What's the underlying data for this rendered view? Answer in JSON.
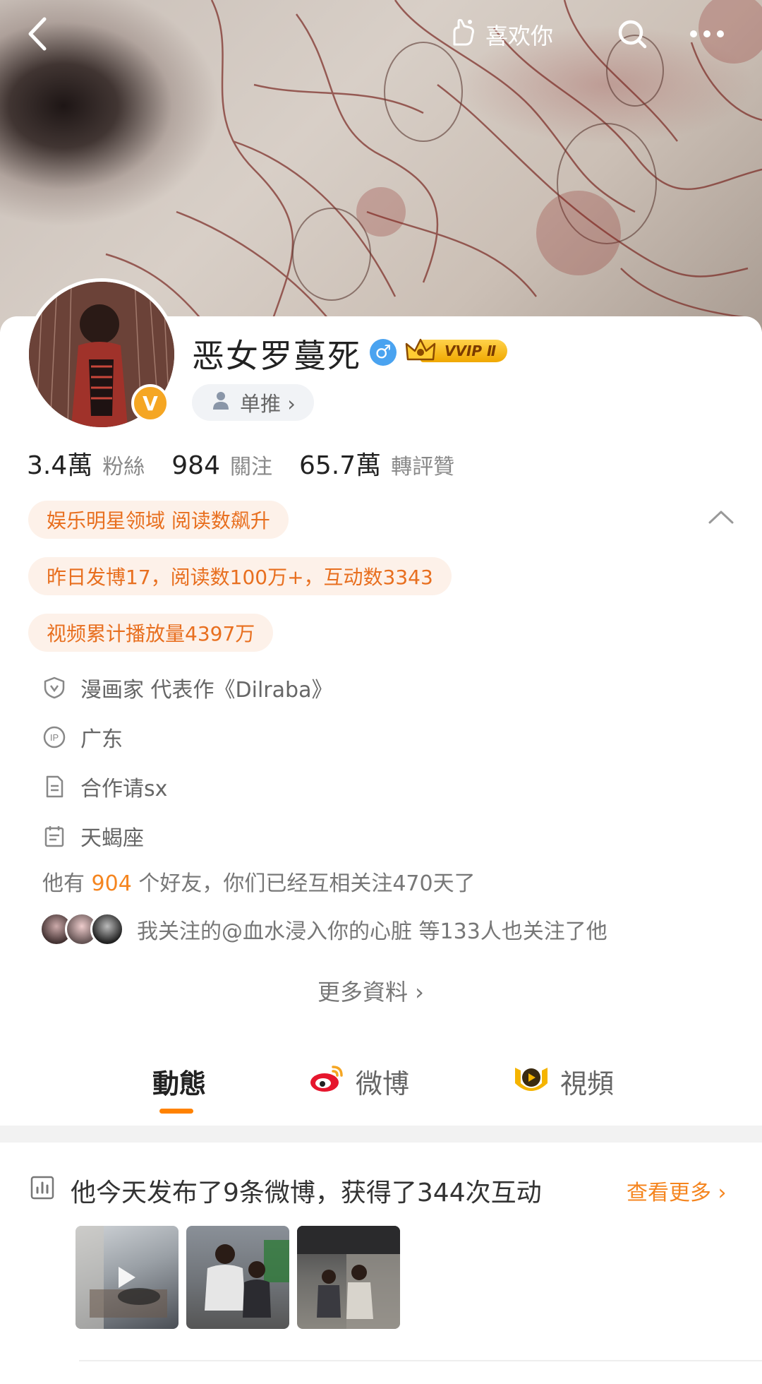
{
  "header": {
    "like_label": "喜欢你"
  },
  "profile": {
    "name": "恶女罗蔓死",
    "gender_symbol": "♂",
    "vip_label": "VVIP Ⅱ",
    "verified_symbol": "V",
    "tag_label": "单推 ›"
  },
  "stats": [
    {
      "value": "3.4萬",
      "label": "粉絲"
    },
    {
      "value": "984",
      "label": "關注"
    },
    {
      "value": "65.7萬",
      "label": "轉評贊"
    }
  ],
  "honors": [
    "娱乐明星领域 阅读数飙升",
    "昨日发博17，阅读数100万+，互动数3343",
    "视频累计播放量4397万"
  ],
  "info": {
    "profession": "漫画家 代表作《Dilraba》",
    "ip_location": "广东",
    "bio": "合作请sx",
    "zodiac": "天蝎座"
  },
  "friends": {
    "prefix": "他有 ",
    "count": "904",
    "suffix": " 个好友，你们已经互相关注470天了"
  },
  "mutual": {
    "text": "我关注的@血水浸入你的心脏 等133人也关注了他"
  },
  "more_info_label": "更多資料 ›",
  "tabs": [
    {
      "label": "動態",
      "active": true
    },
    {
      "label": "微博",
      "active": false
    },
    {
      "label": "視頻",
      "active": false
    }
  ],
  "summary": {
    "text": "他今天发布了9条微博，获得了344次互动",
    "see_more_label": "查看更多 ›"
  },
  "colors": {
    "accent_orange": "#ff8200",
    "honor_text": "#e86f1f",
    "honor_bg": "#fdf1e9",
    "gender_blue": "#4aa3f0"
  }
}
